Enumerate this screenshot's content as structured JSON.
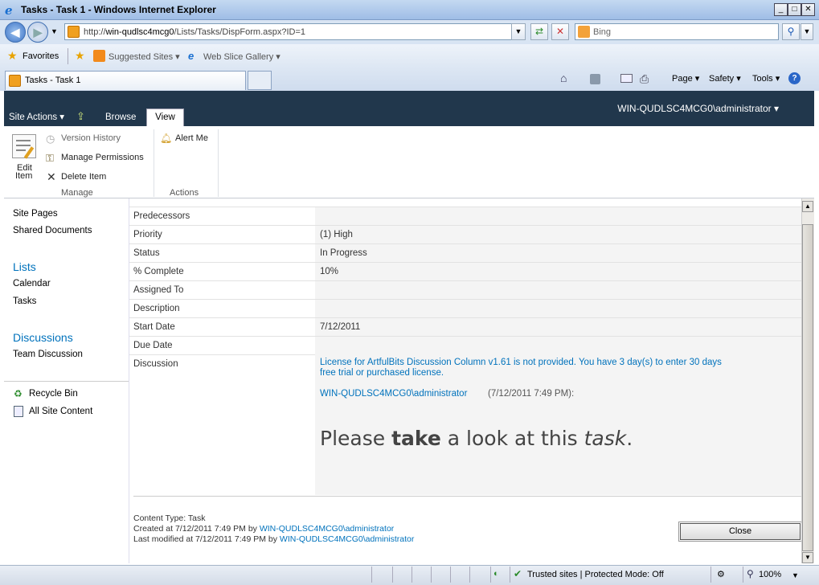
{
  "window": {
    "title": "Tasks - Task 1 - Windows Internet Explorer"
  },
  "address": {
    "url_prefix": "http://",
    "url_host": "win-qudlsc4mcg0",
    "url_path": "/Lists/Tasks/DispForm.aspx?ID=1",
    "search_placeholder": "Bing"
  },
  "favorites": {
    "favorites_label": "Favorites",
    "suggested_sites": "Suggested Sites ▾",
    "web_slice_gallery": "Web Slice Gallery ▾"
  },
  "tabs": [
    {
      "label": "Tasks - Task 1"
    }
  ],
  "command_bar": {
    "page": "Page ▾",
    "safety": "Safety ▾",
    "tools": "Tools ▾"
  },
  "sharepoint": {
    "site_actions": "Site Actions ▾",
    "browse_tab": "Browse",
    "view_tab": "View",
    "user": "WIN-QUDLSC4MCG0\\administrator ▾"
  },
  "ribbon": {
    "edit_item_line1": "Edit",
    "edit_item_line2": "Item",
    "version_history": "Version History",
    "manage_permissions": "Manage Permissions",
    "delete_item": "Delete Item",
    "manage_group": "Manage",
    "alert_me": "Alert Me",
    "actions_group": "Actions"
  },
  "leftnav": {
    "site_pages": "Site Pages",
    "shared_documents": "Shared Documents",
    "lists_heading": "Lists",
    "calendar": "Calendar",
    "tasks": "Tasks",
    "discussions_heading": "Discussions",
    "team_discussion": "Team Discussion",
    "recycle_bin": "Recycle Bin",
    "all_site_content": "All Site Content"
  },
  "fields": [
    {
      "label": "Predecessors",
      "value": ""
    },
    {
      "label": "Priority",
      "value": "(1) High"
    },
    {
      "label": "Status",
      "value": "In Progress"
    },
    {
      "label": "% Complete",
      "value": "10%"
    },
    {
      "label": "Assigned To",
      "value": ""
    },
    {
      "label": "Description",
      "value": ""
    },
    {
      "label": "Start Date",
      "value": "7/12/2011"
    },
    {
      "label": "Due Date",
      "value": ""
    }
  ],
  "discussion": {
    "label": "Discussion",
    "license_line1": "License for ArtfulBits Discussion Column v1.61 is not provided. You have 3 day(s) to enter 30 days",
    "license_line2": "free trial or purchased license.",
    "author": "WIN-QUDLSC4MCG0\\administrator",
    "timestamp": "(7/12/2011 7:49 PM):",
    "msg_part1": "Please ",
    "msg_bold": "take",
    "msg_part2": " a look at this ",
    "msg_italic": "task",
    "msg_part3": "."
  },
  "footer": {
    "content_type": "Content Type: Task",
    "created_prefix": "Created at 7/12/2011 7:49 PM by ",
    "created_by": "WIN-QUDLSC4MCG0\\administrator",
    "modified_prefix": "Last modified at 7/12/2011 7:49 PM by ",
    "modified_by": "WIN-QUDLSC4MCG0\\administrator",
    "close_button": "Close"
  },
  "status": {
    "zone": "Trusted sites | Protected Mode: Off",
    "zoom": "100%"
  },
  "colors": {
    "sp_bar": "#21374c",
    "link": "#0072bc"
  }
}
